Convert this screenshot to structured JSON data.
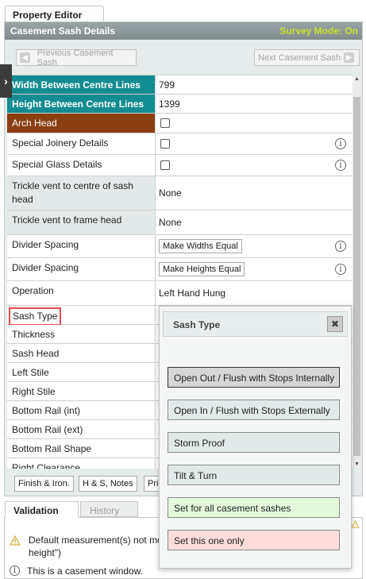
{
  "top_tab": "Property Editor",
  "header": {
    "title": "Casement Sash Details",
    "survey_mode": "Survey Mode: On"
  },
  "nav": {
    "prev": "Previous Casement Sash",
    "next": "Next Casement Sash"
  },
  "rows": {
    "width": {
      "label": "Width Between Centre Lines",
      "value": "799"
    },
    "height": {
      "label": "Height Between Centre Lines",
      "value": "1399"
    },
    "arch_head": {
      "label": "Arch Head"
    },
    "special_joinery": {
      "label": "Special Joinery Details"
    },
    "special_glass": {
      "label": "Special Glass Details"
    },
    "trickle_sash": {
      "label": "Trickle vent to centre of sash head",
      "value": "None"
    },
    "trickle_frame": {
      "label": "Trickle vent to frame head",
      "value": "None"
    },
    "divider_widths": {
      "label": "Divider Spacing",
      "button": "Make Widths Equal"
    },
    "divider_heights": {
      "label": "Divider Spacing",
      "button": "Make Heights Equal"
    },
    "operation": {
      "label": "Operation",
      "value": "Left Hand Hung"
    },
    "sash_type": {
      "label": "Sash Type"
    },
    "thickness": {
      "label": "Thickness"
    },
    "sash_head": {
      "label": "Sash Head"
    },
    "left_stile": {
      "label": "Left Stile"
    },
    "right_stile": {
      "label": "Right Stile"
    },
    "bottom_rail_int": {
      "label": "Bottom Rail (int)"
    },
    "bottom_rail_ext": {
      "label": "Bottom Rail (ext)"
    },
    "bottom_rail_shape": {
      "label": "Bottom Rail Shape"
    },
    "right_clearance": {
      "label": "Right Clearance"
    }
  },
  "bottom_buttons": {
    "finish": "Finish & Iron.",
    "hs_notes": "H & S, Notes",
    "pri": "Pri"
  },
  "tabs": {
    "validation": "Validation",
    "history": "History"
  },
  "validation": {
    "msg1_line1": "Default measurement(s) not mo",
    "msg1_line2": "height\")",
    "msg2": "This is a casement window."
  },
  "popup": {
    "title": "Sash Type",
    "options": [
      "Open Out / Flush with Stops Internally",
      "Open In / Flush with Stops Externally",
      "Storm Proof",
      "Tilt & Turn",
      "Set for all casement sashes",
      "Set this one only"
    ]
  },
  "icons": {
    "info": "info-icon",
    "close": "close-icon",
    "warning": "warning-icon",
    "sidebar_toggle": "chevron-right-icon"
  },
  "colors": {
    "teal_label": "#138c91",
    "brown_label": "#8b3e12",
    "survey_mode": "#c7e12a",
    "highlight": "#e84a4a",
    "green_option": "#e4f9da",
    "red_option": "#ffdcdc"
  }
}
